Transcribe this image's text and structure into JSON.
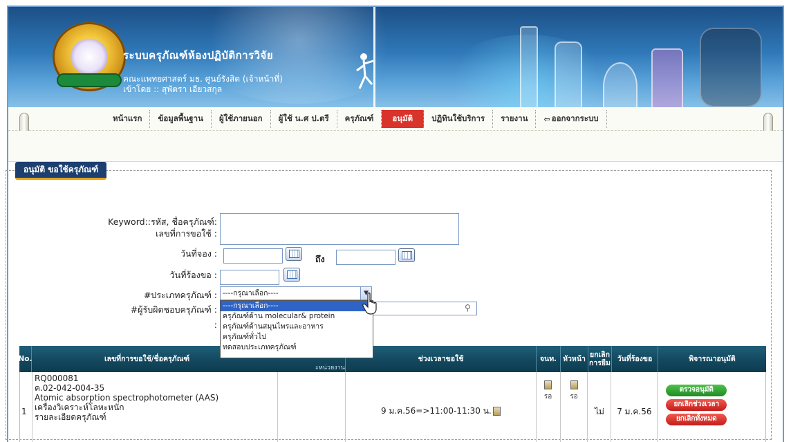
{
  "header": {
    "title": "ระบบครุภัณฑ์ห้องปฏิบัติการวิจัย",
    "subtitle": "คณะแพทยศาสตร์ มธ. ศูนย์รังสิต (เจ้าหน้าที่)",
    "login": "เข้าโดย :: สุพัตรา เอียวสกุล"
  },
  "menu": {
    "items": [
      "หน้าแรก",
      "ข้อมูลพื้นฐาน",
      "ผู้ใช้ภายนอก",
      "ผู้ใช้ น.ศ ป.ตรี",
      "ครุภัณฑ์",
      "อนุมัติ",
      "ปฏิทินใช้บริการ",
      "รายงาน",
      "ออกจากระบบ"
    ],
    "active": "อนุมัติ"
  },
  "panel": {
    "legend": "อนุมัติ ขอใช้ครุภัณฑ์"
  },
  "form": {
    "keyword_label": "Keyword::รหัส, ชื่อครุภัณฑ์:",
    "request_no_label": "เลขที่การขอใช้ :",
    "booking_date_label": "วันที่จอง :",
    "to_label": "ถึง",
    "request_date_label": "วันที่ร้องขอ :",
    "type_label": "#ประเภทครุภัณฑ์ :",
    "owner_label": "#ผู้รับผิดชอบครุภัณฑ์ :",
    "hidden_label": ":",
    "type_selected": "----กรุณาเลือก----",
    "type_options": [
      "----กรุณาเลือก----",
      "ครุภัณฑ์ด้าน molecular& protein",
      "ครุภัณฑ์ด้านสมุนไพรและอาหาร",
      "ครุภัณฑ์ทั่วไป",
      "ทดสอบประเภทครุภัณฑ์"
    ]
  },
  "table": {
    "headers": {
      "no": "No.",
      "request": "เลขที่การขอใช้/ชื่อครุภัณฑ์",
      "unit": "ะหน่วยงาน",
      "time": "ช่วงเวลาขอใช้",
      "staff": "จนท.",
      "head": "หัวหน้า",
      "cancel": "ยกเลิก การยืม",
      "req_date": "วันที่ร้องขอ",
      "approve": "พิจารณาอนุมัติ"
    },
    "rows": [
      {
        "no": "1",
        "request_id": "RQ000081",
        "asset_code": "ค.02-042-004-35",
        "asset_name": "Atomic absorption spectrophotometer (AAS)",
        "asset_thai": "เครื่องวิเคราะห์โลหะหนัก",
        "detail": "รายละเอียดครุภัณฑ์",
        "time": "9 ม.ค.56=>11:00-11:30 น.",
        "staff_status": "รอ",
        "head_status": "รอ",
        "cancelled": "ไม่",
        "request_date": "7 ม.ค.56",
        "buttons": [
          "ตรวจอนุมัติ",
          "ยกเลิกช่วงเวลา",
          "ยกเลิกทั้งหมด"
        ]
      }
    ]
  }
}
